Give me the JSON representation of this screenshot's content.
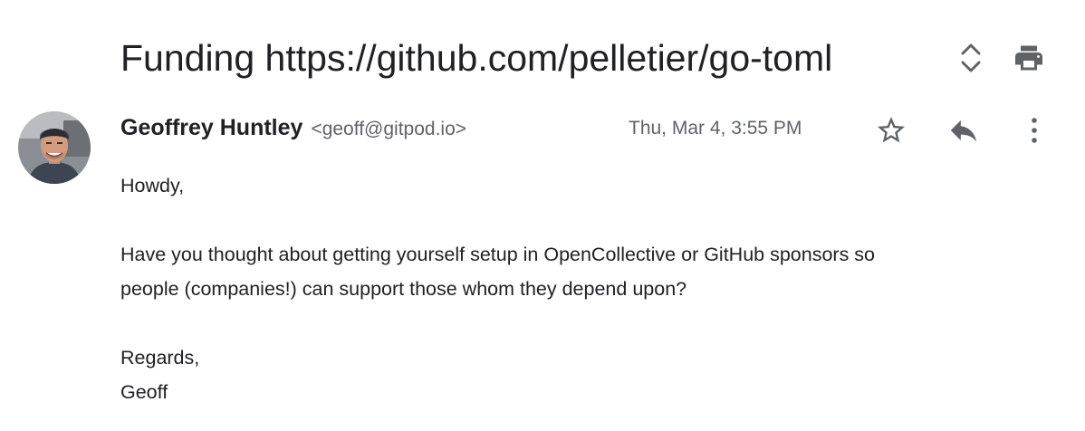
{
  "subject": "Funding https://github.com/pelletier/go-toml",
  "sender": {
    "name": "Geoffrey Huntley",
    "email": "<geoff@gitpod.io>"
  },
  "timestamp": "Thu, Mar 4, 3:55 PM",
  "body": {
    "greeting": "Howdy,",
    "paragraph_line1": "Have you thought about getting yourself setup in OpenCollective or GitHub sponsors so",
    "paragraph_line2": "people (companies!) can support those whom they depend upon?",
    "signoff": "Regards,",
    "signature": "Geoff"
  },
  "icons": {
    "expand": "unfold-more-icon",
    "print": "print-icon",
    "star": "star-outline-icon",
    "reply": "reply-icon",
    "more": "more-vert-icon"
  },
  "colors": {
    "text": "#202124",
    "secondary": "#5f6368",
    "icon": "#5f6368"
  }
}
